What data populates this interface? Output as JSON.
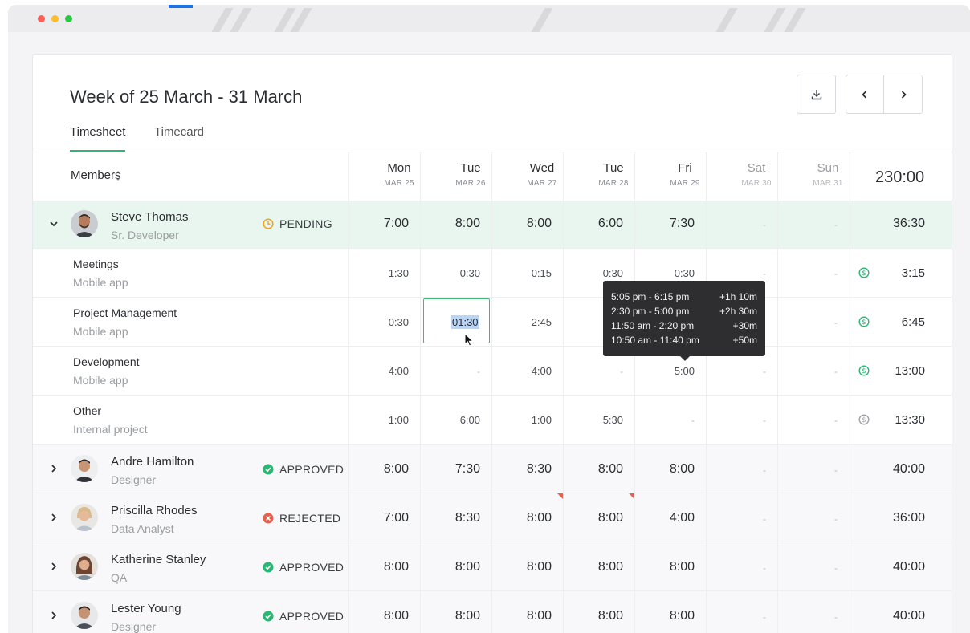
{
  "header": {
    "title": "Week of 25 March - 31 March",
    "tabs": [
      {
        "label": "Timesheet",
        "active": true
      },
      {
        "label": "Timecard",
        "active": false
      }
    ],
    "icons": {
      "download": "download-icon",
      "prev": "chevron-left-icon",
      "next": "chevron-right-icon"
    }
  },
  "table": {
    "members_label": "Members",
    "grand_total": "230:00",
    "days": [
      {
        "name": "Mon",
        "date": "MAR 25",
        "weekend": false
      },
      {
        "name": "Tue",
        "date": "MAR 26",
        "weekend": false
      },
      {
        "name": "Wed",
        "date": "MAR 27",
        "weekend": false
      },
      {
        "name": "Tue",
        "date": "MAR 28",
        "weekend": false
      },
      {
        "name": "Fri",
        "date": "MAR 29",
        "weekend": false
      },
      {
        "name": "Sat",
        "date": "MAR 30",
        "weekend": true
      },
      {
        "name": "Sun",
        "date": "MAR 31",
        "weekend": true
      }
    ],
    "expanded_member": {
      "name": "Steve Thomas",
      "role": "Sr. Developer",
      "status": "PENDING",
      "hours": [
        "7:00",
        "8:00",
        "8:00",
        "6:00",
        "7:30",
        "-",
        "-"
      ],
      "total": "36:30",
      "tasks": [
        {
          "task": "Meetings",
          "project": "Mobile app",
          "hours": [
            "1:30",
            "0:30",
            "0:15",
            "0:30",
            "0:30",
            "-",
            "-"
          ],
          "total": "3:15",
          "billable": true
        },
        {
          "task": "Project Management",
          "project": "Mobile app",
          "hours": [
            "0:30",
            "01:30",
            "2:45",
            "",
            "",
            "-",
            "-"
          ],
          "total": "6:45",
          "billable": true
        },
        {
          "task": "Development",
          "project": "Mobile app",
          "hours": [
            "4:00",
            "-",
            "4:00",
            "-",
            "5:00",
            "-",
            "-"
          ],
          "total": "13:00",
          "billable": true
        },
        {
          "task": "Other",
          "project": "Internal project",
          "hours": [
            "1:00",
            "6:00",
            "1:00",
            "5:30",
            "-",
            "-",
            "-"
          ],
          "total": "13:30",
          "billable": false
        }
      ]
    },
    "members": [
      {
        "name": "Andre Hamilton",
        "role": "Designer",
        "status": "APPROVED",
        "hours": [
          "8:00",
          "7:30",
          "8:30",
          "8:00",
          "8:00",
          "-",
          "-"
        ],
        "total": "40:00"
      },
      {
        "name": "Priscilla Rhodes",
        "role": "Data Analyst",
        "status": "REJECTED",
        "hours": [
          "7:00",
          "8:30",
          "8:00",
          "8:00",
          "4:00",
          "-",
          "-"
        ],
        "total": "36:00"
      },
      {
        "name": "Katherine Stanley",
        "role": "QA",
        "status": "APPROVED",
        "hours": [
          "8:00",
          "8:00",
          "8:00",
          "8:00",
          "8:00",
          "-",
          "-"
        ],
        "total": "40:00"
      },
      {
        "name": "Lester Young",
        "role": "Designer",
        "status": "APPROVED",
        "hours": [
          "8:00",
          "8:00",
          "8:00",
          "8:00",
          "8:00",
          "-",
          "-"
        ],
        "total": "40:00"
      }
    ]
  },
  "editing": {
    "value": "01:30"
  },
  "tooltip": {
    "entries": [
      {
        "range": "5:05 pm - 6:15 pm",
        "delta": "+1h 10m"
      },
      {
        "range": "2:30 pm - 5:00 pm",
        "delta": "+2h 30m"
      },
      {
        "range": "11:50 am - 2:20 pm",
        "delta": "+30m"
      },
      {
        "range": "10:50 am - 11:40 pm",
        "delta": "+50m"
      }
    ]
  },
  "colors": {
    "accent": "#2ab673",
    "pending": "#f0a31a",
    "approved": "#2ab673",
    "rejected": "#e8604c",
    "expanded_row_bg": "#e9f6ef"
  }
}
